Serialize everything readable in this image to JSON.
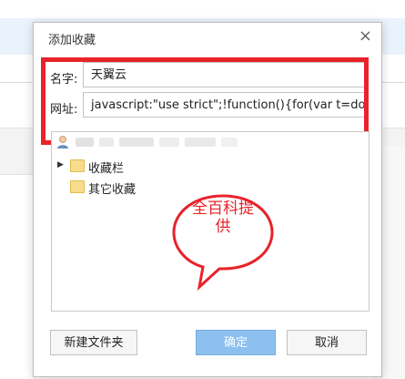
{
  "dialog": {
    "title": "添加收藏",
    "close_glyph": "×"
  },
  "form": {
    "name_label": "名字:",
    "name_value": "天翼云",
    "url_label": "网址:",
    "url_value": "javascript:\"use strict\";!function(){for(var t=documer"
  },
  "tree": {
    "items": [
      {
        "label": "收藏栏",
        "expander": "▶"
      },
      {
        "label": "其它收藏"
      }
    ]
  },
  "annotation": {
    "line1": "全百科提",
    "line2": "供"
  },
  "buttons": {
    "new_folder": "新建文件夹",
    "ok": "确定",
    "cancel": "取消"
  },
  "colors": {
    "highlight_red": "#e8232a",
    "primary_button": "#8cc0ee",
    "folder_yellow": "#f7dc8c"
  }
}
